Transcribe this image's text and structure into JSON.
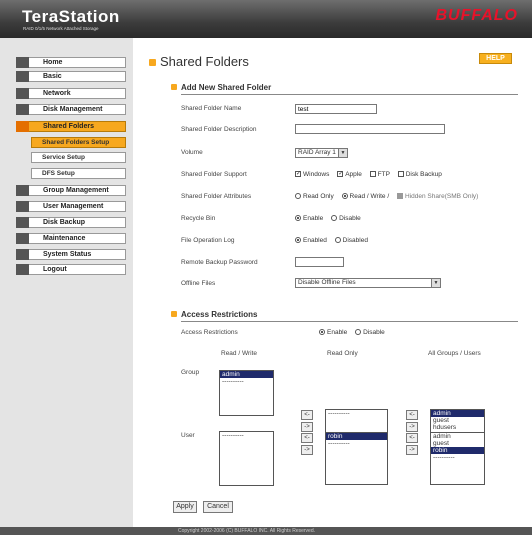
{
  "header": {
    "product": "TeraStation",
    "subtitle": "RAID 0/1/5 Network Attached Storage",
    "brand": "BUFFALO"
  },
  "sidebar": {
    "items": [
      {
        "label": "Home"
      },
      {
        "label": "Basic"
      },
      {
        "label": "Network"
      },
      {
        "label": "Disk Management"
      },
      {
        "label": "Shared Folders"
      },
      {
        "label": "Group Management"
      },
      {
        "label": "User Management"
      },
      {
        "label": "Disk Backup"
      },
      {
        "label": "Maintenance"
      },
      {
        "label": "System Status"
      },
      {
        "label": "Logout"
      }
    ],
    "subitems": [
      {
        "label": "Shared Folders Setup"
      },
      {
        "label": "Service Setup"
      },
      {
        "label": "DFS Setup"
      }
    ]
  },
  "page": {
    "title": "Shared Folders",
    "help": "HELP"
  },
  "add_section": {
    "title": "Add New Shared Folder",
    "name_label": "Shared Folder Name",
    "name_value": "test",
    "desc_label": "Shared Folder Description",
    "desc_value": "",
    "volume_label": "Volume",
    "volume_value": "RAID Array 1",
    "support_label": "Shared Folder Support",
    "support_options": [
      {
        "label": "Windows",
        "checked": true
      },
      {
        "label": "Apple",
        "checked": true
      },
      {
        "label": "FTP",
        "checked": false
      },
      {
        "label": "Disk Backup",
        "checked": false
      }
    ],
    "attr_label": "Shared Folder Attributes",
    "attr_options": [
      "Read Only",
      "Read / Write /"
    ],
    "hidden_share": "Hidden Share(SMB Only)",
    "recycle_label": "Recycle Bin",
    "recycle_options": [
      "Enable",
      "Disable"
    ],
    "oplog_label": "File Operation Log",
    "oplog_options": [
      "Enabled",
      "Disabled"
    ],
    "rbpw_label": "Remote Backup Password",
    "rbpw_value": "",
    "offline_label": "Offline Files",
    "offline_value": "Disable Offline Files"
  },
  "access_section": {
    "title": "Access Restrictions",
    "label": "Access Restrictions",
    "options": [
      "Enable",
      "Disable"
    ],
    "col_rw": "Read / Write",
    "col_ro": "Read Only",
    "col_all": "All Groups / Users",
    "group_label": "Group",
    "user_label": "User",
    "group_rw": [
      "admin",
      "----------"
    ],
    "group_ro": [
      "----------"
    ],
    "group_all": [
      "admin",
      "guest",
      "hdusers",
      "----------"
    ],
    "user_rw": [
      "----------"
    ],
    "user_ro": [
      "robin",
      "----------"
    ],
    "user_all": [
      "admin",
      "guest",
      "robin",
      "----------"
    ],
    "left_arrow": "<-",
    "right_arrow": "->"
  },
  "buttons": {
    "apply": "Apply",
    "cancel": "Cancel"
  },
  "footer": "Copyright 2002-2006 (C) BUFFALO INC. All Rights Reserved."
}
